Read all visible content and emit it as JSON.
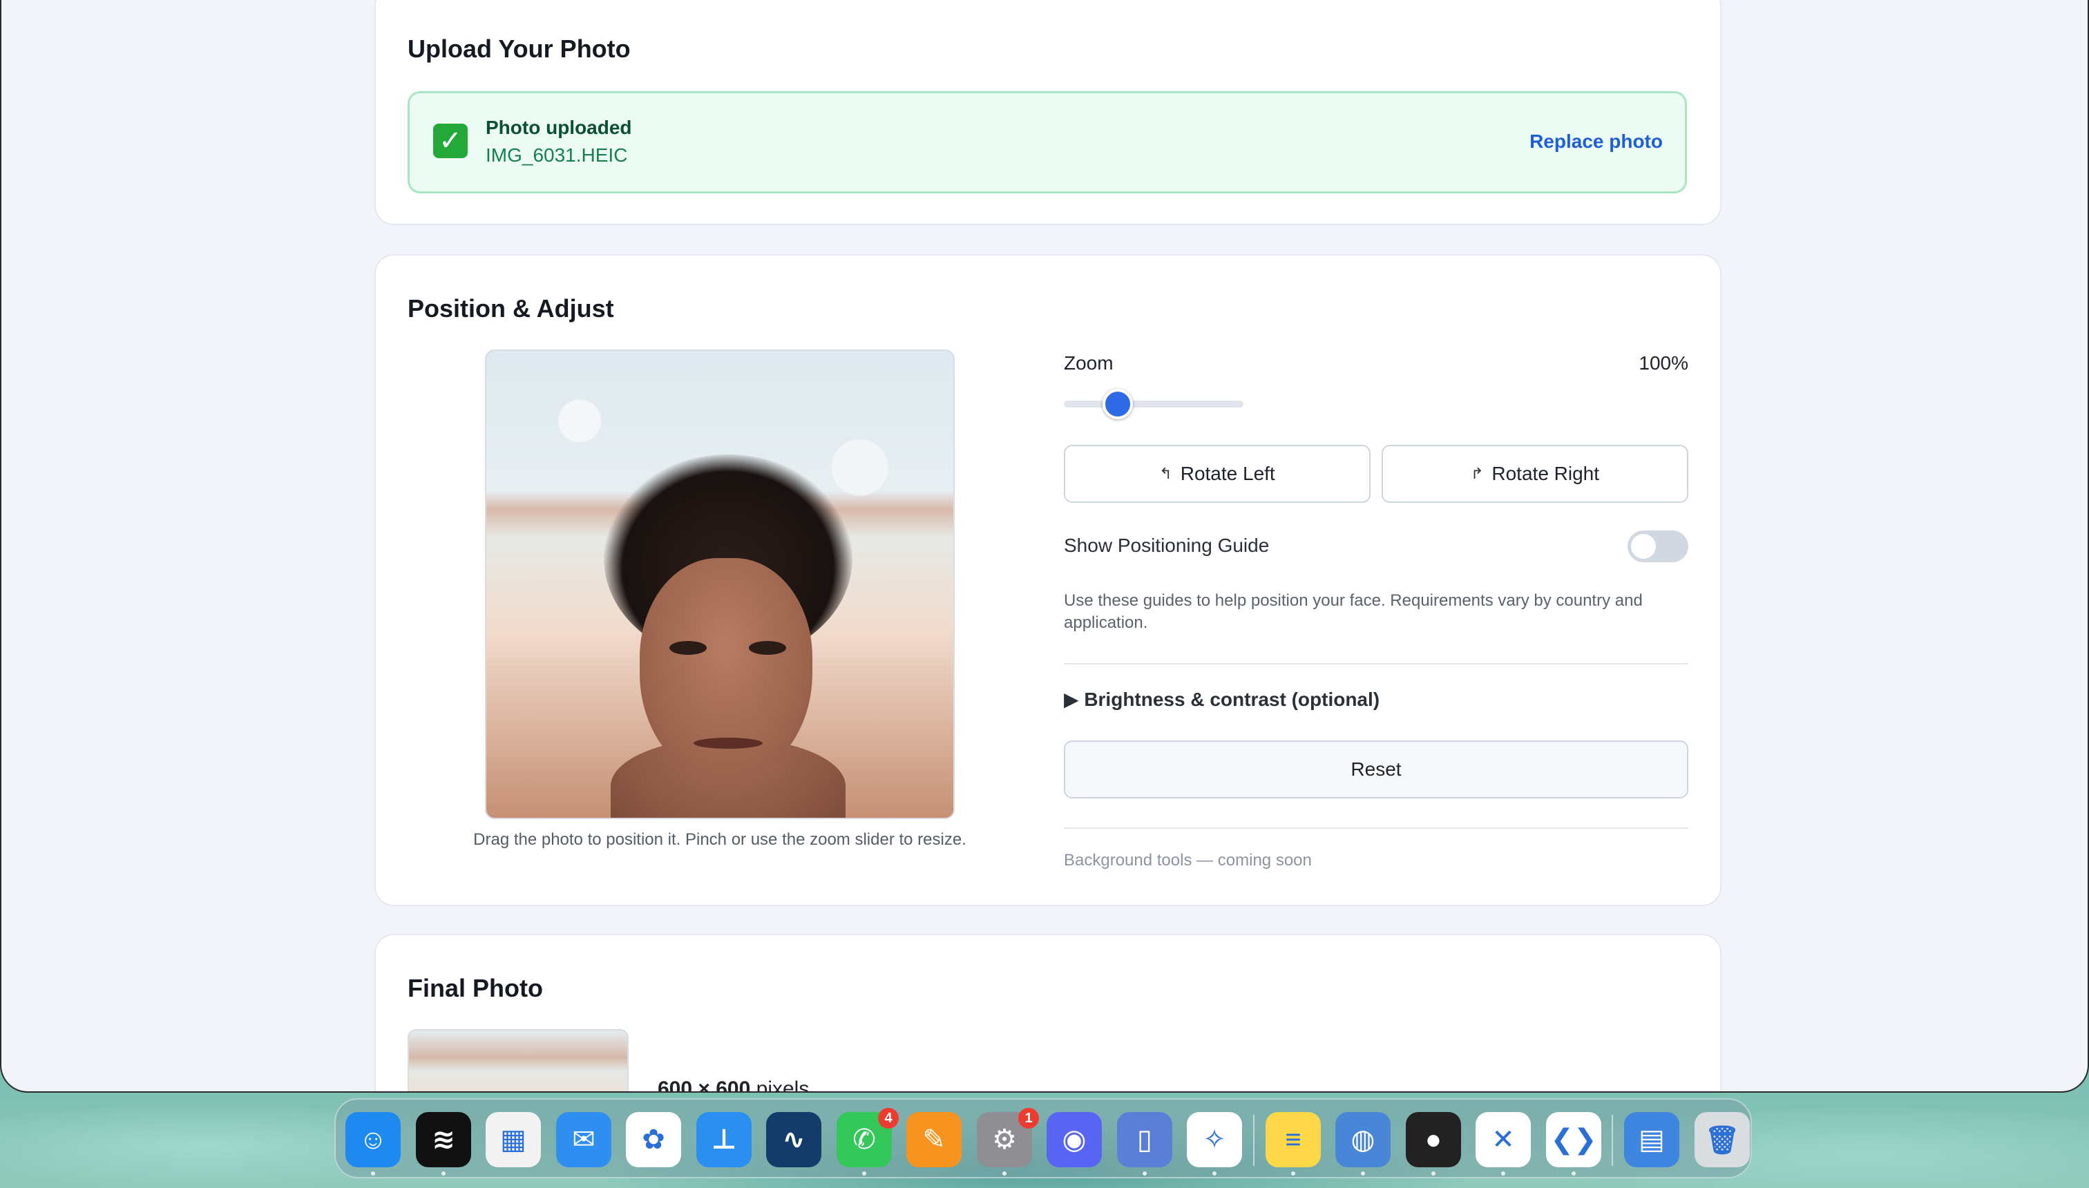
{
  "upload": {
    "title": "Upload Your Photo",
    "status": "Photo uploaded",
    "filename": "IMG_6031.HEIC",
    "replace_label": "Replace photo"
  },
  "position": {
    "title": "Position & Adjust",
    "zoom_label": "Zoom",
    "zoom_value": "100%",
    "zoom_fraction": 0.3,
    "rotate_left_label": "Rotate Left",
    "rotate_right_label": "Rotate Right",
    "guide_label": "Show Positioning Guide",
    "guide_on": false,
    "guide_help": "Use these guides to help position your face. Requirements vary by country and application.",
    "brightness_label": "▶ Brightness & contrast (optional)",
    "reset_label": "Reset",
    "bg_tools": "Background tools — coming soon",
    "photo_caption": "Drag the photo to position it. Pinch or use the zoom slider to resize."
  },
  "final": {
    "title": "Final Photo",
    "dims": "600 × 600",
    "dims_unit": " pixels"
  },
  "dock": {
    "items": [
      {
        "name": "finder",
        "glyph": "☺",
        "color": "#1e8af0",
        "running": true
      },
      {
        "name": "spotify",
        "glyph": "≋",
        "color": "#111111",
        "running": true
      },
      {
        "name": "launchpad",
        "glyph": "▦",
        "color": "#f2f2f2",
        "running": false
      },
      {
        "name": "mail",
        "glyph": "✉",
        "color": "#2f8ff0",
        "running": false
      },
      {
        "name": "photos",
        "glyph": "✿",
        "color": "#ffffff",
        "running": false
      },
      {
        "name": "keynote",
        "glyph": "⊥",
        "color": "#2a8ff0",
        "running": false
      },
      {
        "name": "freeform",
        "glyph": "∿",
        "color": "#143c6a",
        "running": false
      },
      {
        "name": "messages",
        "glyph": "✆",
        "color": "#34c759",
        "running": true,
        "badge": "4"
      },
      {
        "name": "pages",
        "glyph": "✎",
        "color": "#f7931e",
        "running": false
      },
      {
        "name": "system-settings",
        "glyph": "⚙",
        "color": "#8e8e93",
        "running": true,
        "badge": "1"
      },
      {
        "name": "discord",
        "glyph": "◉",
        "color": "#5865f2",
        "running": false
      },
      {
        "name": "simulator",
        "glyph": "▯",
        "color": "#5b7fd6",
        "running": true
      },
      {
        "name": "safari",
        "glyph": "✧",
        "color": "#ffffff",
        "running": true
      },
      {
        "name": "notes",
        "glyph": "≡",
        "color": "#ffd84a",
        "running": true
      },
      {
        "name": "preview",
        "glyph": "◍",
        "color": "#4a86d8",
        "running": true
      },
      {
        "name": "screen-recorder",
        "glyph": "●",
        "color": "#222222",
        "running": true
      },
      {
        "name": "capcut",
        "glyph": "✕",
        "color": "#ffffff",
        "running": true
      },
      {
        "name": "vscode",
        "glyph": "❮❯",
        "color": "#ffffff",
        "running": true
      },
      {
        "name": "archive-utility",
        "glyph": "▤",
        "color": "#3f86e0",
        "running": false
      },
      {
        "name": "trash",
        "glyph": "🗑",
        "color": "#d9dde0",
        "running": false
      }
    ]
  }
}
